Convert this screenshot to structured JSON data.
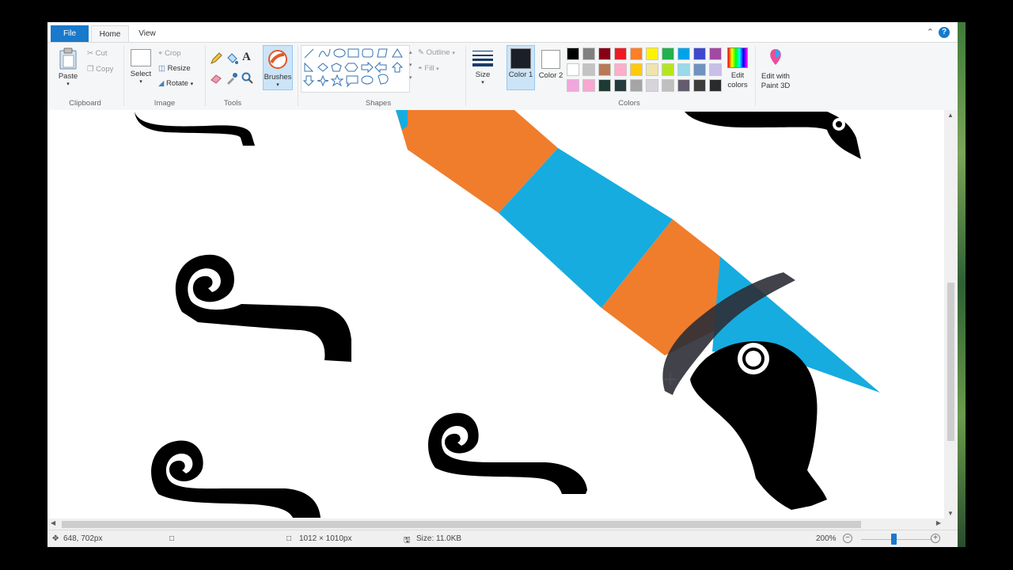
{
  "tabs": {
    "file": "File",
    "home": "Home",
    "view": "View"
  },
  "help_label": "?",
  "clipboard": {
    "paste": "Paste",
    "cut": "Cut",
    "copy": "Copy",
    "group": "Clipboard"
  },
  "image": {
    "select": "Select",
    "crop": "Crop",
    "resize": "Resize",
    "rotate": "Rotate",
    "group": "Image"
  },
  "tools": {
    "group": "Tools",
    "text_glyph": "A"
  },
  "brushes": {
    "label": "Brushes"
  },
  "shapes": {
    "outline": "Outline",
    "fill": "Fill",
    "group": "Shapes"
  },
  "size": {
    "label": "Size"
  },
  "colors": {
    "color1_label": "Color 1",
    "color2_label": "Color 2",
    "color1": "#1b1f27",
    "color2": "#ffffff",
    "edit_colors": "Edit colors",
    "edit_paint3d": "Edit with Paint 3D",
    "group": "Colors",
    "palette_row1": [
      "#000000",
      "#7f7f7f",
      "#880015",
      "#ed1c24",
      "#ff7f27",
      "#fff200",
      "#22b14c",
      "#00a2e8",
      "#3f48cc",
      "#a349a4"
    ],
    "palette_row2": [
      "#ffffff",
      "#c3c3c3",
      "#b97a57",
      "#ffaec9",
      "#ffc90e",
      "#efe4b0",
      "#b5e61d",
      "#99d9ea",
      "#7092be",
      "#c8bfe7"
    ],
    "palette_row3": [
      "#f2a6de",
      "#f7a8d0",
      "#1e3a34",
      "#243a3c",
      "#a5a5a5",
      "#d7d4db",
      "#bfbfbf",
      "#655b6e",
      "#3c3c3c",
      "#2b2b2b"
    ]
  },
  "status": {
    "cursor": "648, 702px",
    "dimensions": "1012 × 1010px",
    "size": "Size: 11.0KB",
    "zoom": "200%"
  }
}
